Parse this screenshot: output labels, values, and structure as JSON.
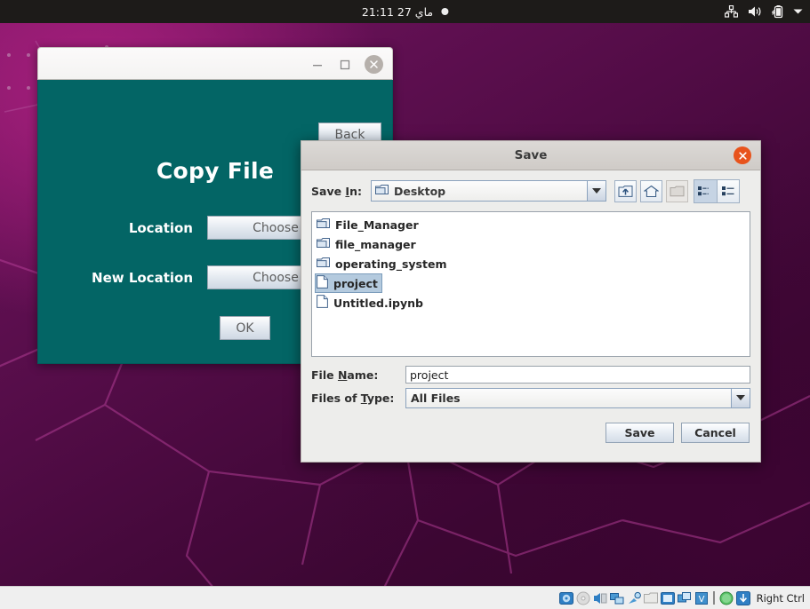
{
  "top_panel": {
    "clock": "ماي 27  21:11",
    "recording_indicator": "recording-dot",
    "tray": [
      {
        "name": "network-icon",
        "label": "Network"
      },
      {
        "name": "volume-icon",
        "label": "Volume"
      },
      {
        "name": "battery-icon",
        "label": "Battery"
      },
      {
        "name": "chevron-down-icon",
        "label": "System menu"
      }
    ]
  },
  "copy_file_window": {
    "title_bar": {
      "minimize_label": "–",
      "maximize_label": "□",
      "close_label": "×"
    },
    "back_label": "Back",
    "heading": "Copy File",
    "rows": [
      {
        "label": "Location",
        "button": "Choose"
      },
      {
        "label": "New Location",
        "button": "Choose"
      }
    ],
    "ok_label": "OK",
    "colors": {
      "body_bg": "#036565",
      "title_bg": "#f7f6f5"
    }
  },
  "save_dialog": {
    "title": "Save",
    "close_label": "×",
    "save_in_label": "Save In:",
    "save_in_value": "Desktop",
    "toolbar": [
      {
        "name": "up-folder-icon",
        "label": "Up One Level",
        "state": "enabled"
      },
      {
        "name": "home-icon",
        "label": "Home",
        "state": "enabled"
      },
      {
        "name": "new-folder-icon",
        "label": "Create New Folder",
        "state": "disabled"
      },
      {
        "name": "list-view-icon",
        "label": "List",
        "state": "selected"
      },
      {
        "name": "details-view-icon",
        "label": "Details",
        "state": "enabled"
      }
    ],
    "files": [
      {
        "name": "File_Manager",
        "type": "folder",
        "selected": false
      },
      {
        "name": "file_manager",
        "type": "folder",
        "selected": false
      },
      {
        "name": "operating_system",
        "type": "folder",
        "selected": false
      },
      {
        "name": "project",
        "type": "file",
        "selected": true
      },
      {
        "name": "Untitled.ipynb",
        "type": "file",
        "selected": false
      }
    ],
    "file_name_label": "File Name:",
    "file_name_mnemonic": "N",
    "file_name_value": "project",
    "files_of_type_label": "Files of Type:",
    "files_of_type_mnemonic": "T",
    "files_of_type_value": "All Files",
    "save_button": "Save",
    "cancel_button": "Cancel",
    "colors": {
      "close_button": "#e8531c",
      "selection": "#b4cade"
    }
  },
  "vbox_status": {
    "icons": [
      {
        "name": "hard-disk-icon",
        "label": "Hard Disks"
      },
      {
        "name": "optical-disk-icon",
        "label": "Optical Drives"
      },
      {
        "name": "audio-icon",
        "label": "Audio"
      },
      {
        "name": "network-adapter-icon",
        "label": "Network"
      },
      {
        "name": "usb-icon",
        "label": "USB Devices"
      },
      {
        "name": "shared-folder-icon",
        "label": "Shared Folders"
      },
      {
        "name": "display-icon",
        "label": "Display"
      },
      {
        "name": "recording-icon",
        "label": "Recording"
      },
      {
        "name": "vm-features-icon",
        "label": "VM Features"
      },
      {
        "name": "mouse-integration-icon",
        "label": "Mouse Integration"
      },
      {
        "name": "host-key-icon",
        "label": "Host Key"
      }
    ],
    "host_key": "Right Ctrl"
  }
}
